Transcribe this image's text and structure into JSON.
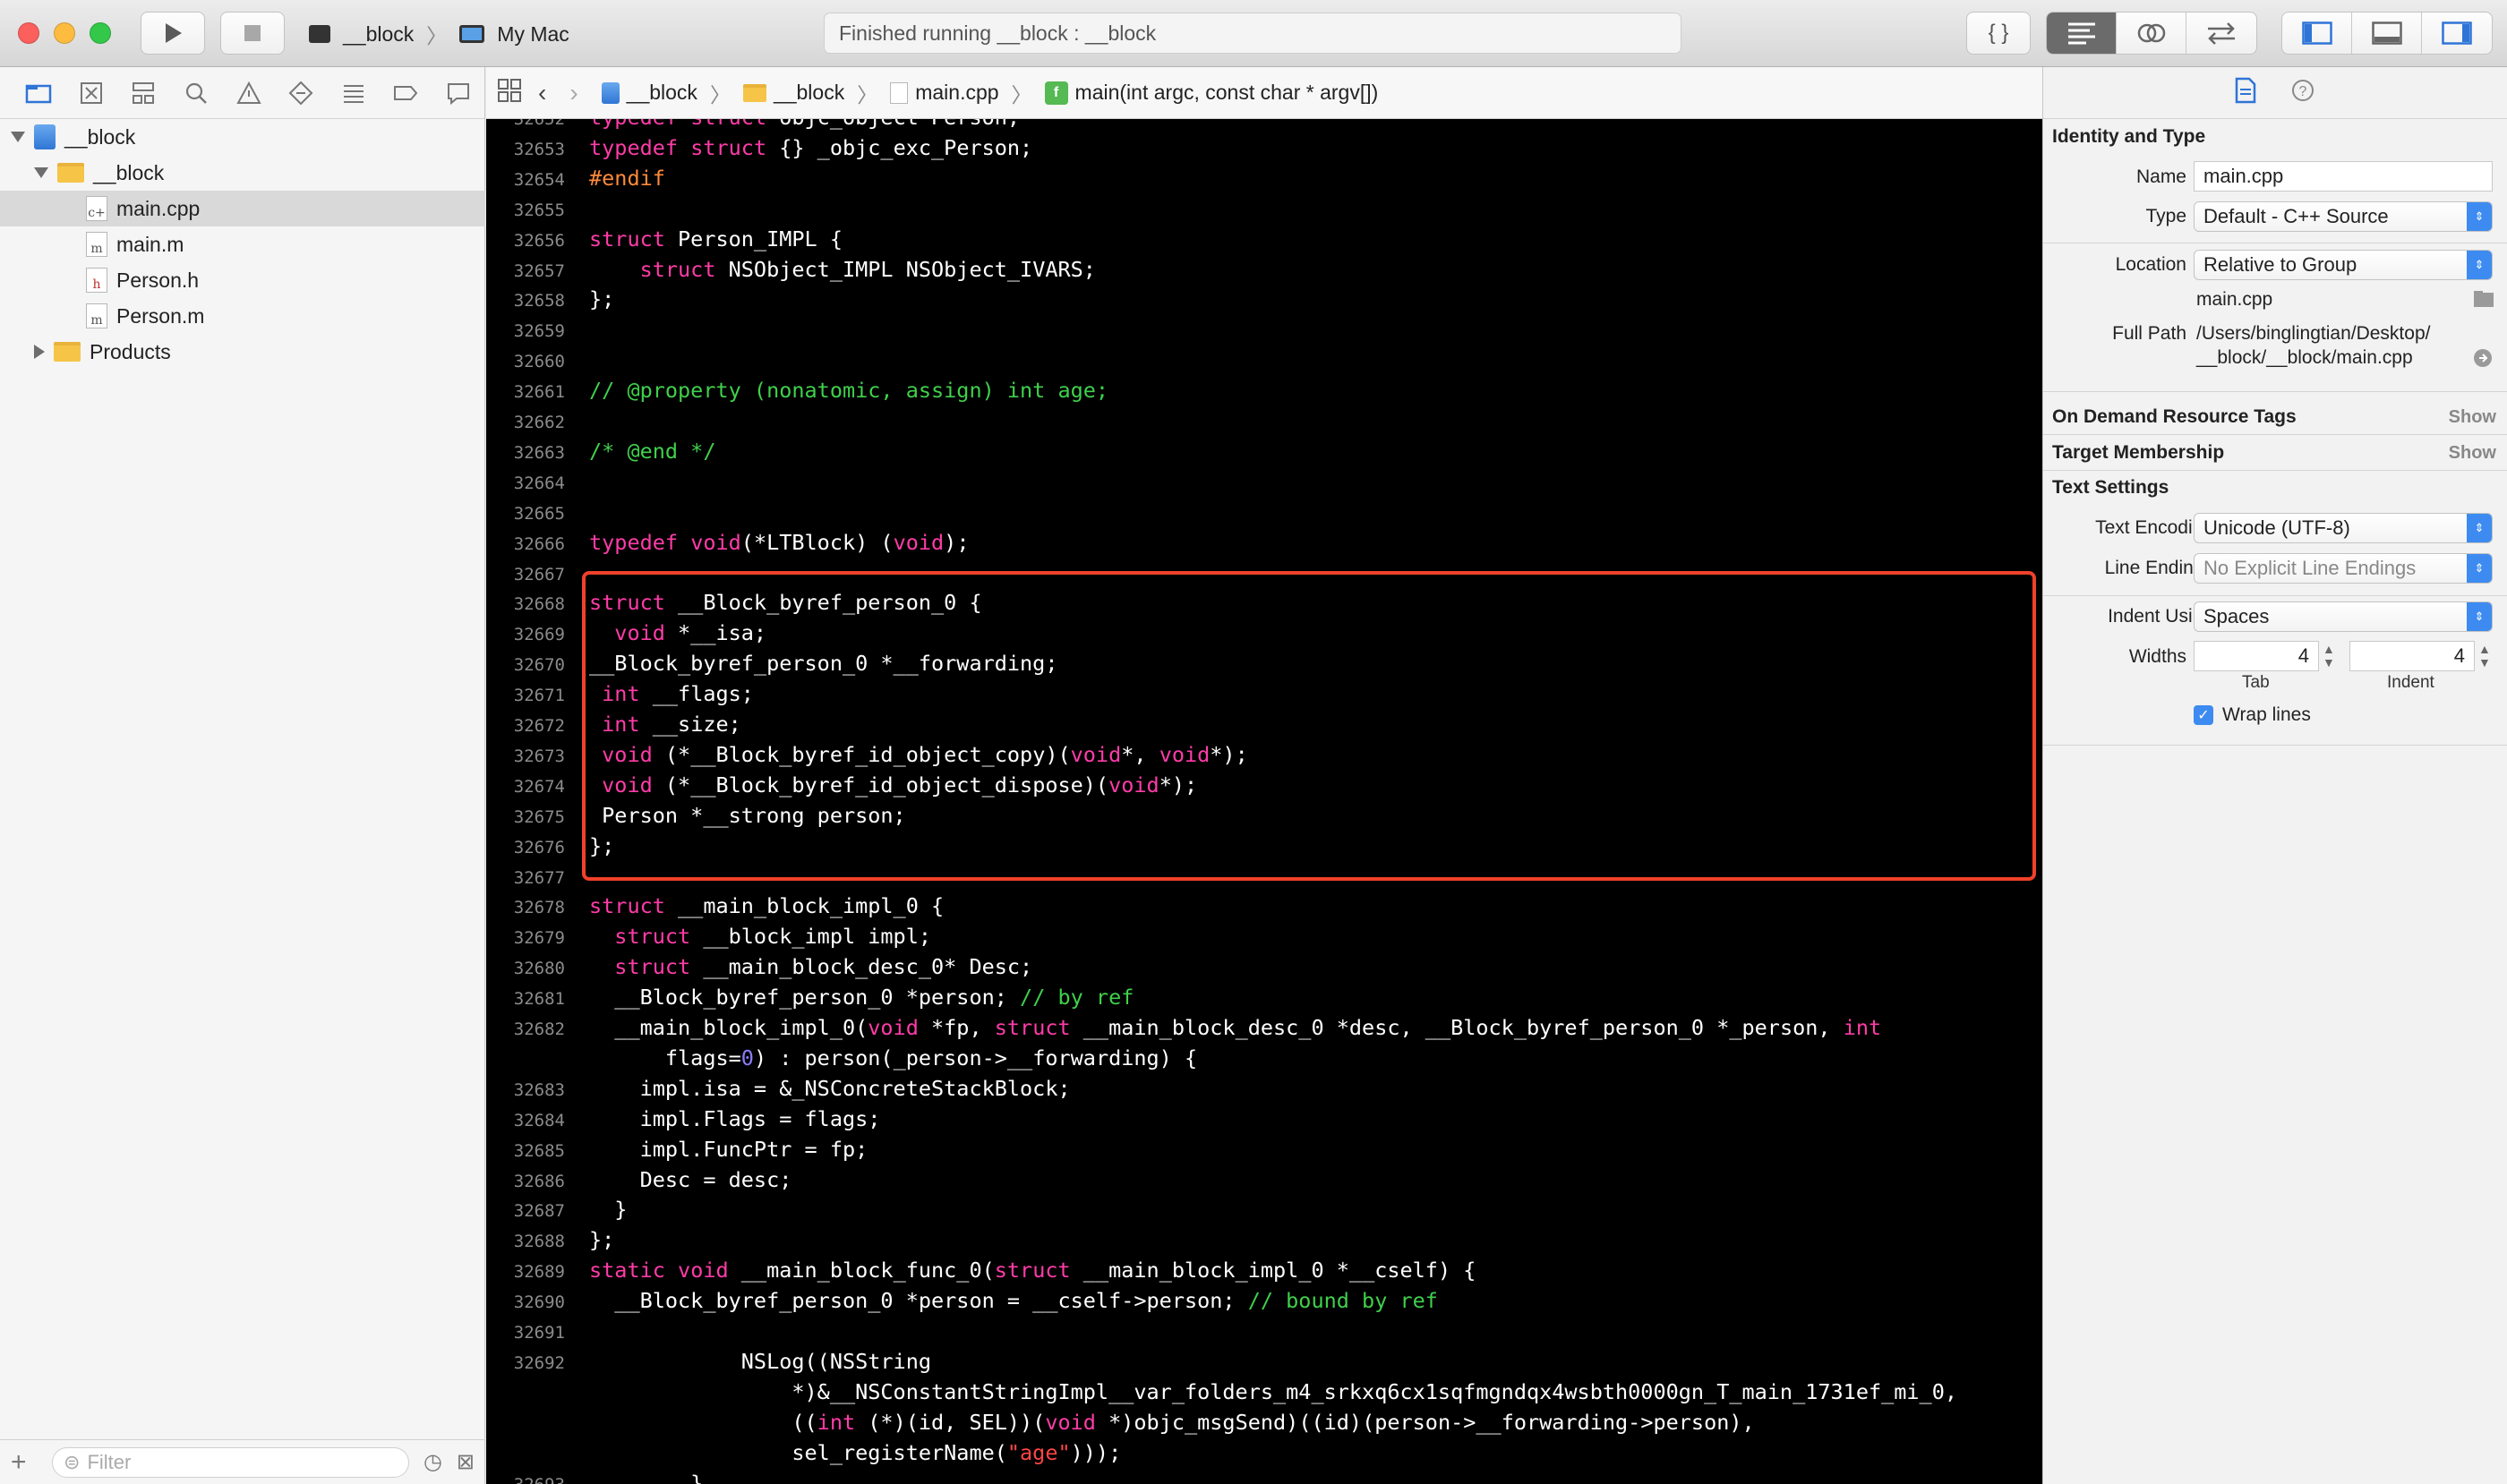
{
  "toolbar": {
    "scheme": "__block",
    "destination": "My Mac",
    "activity": "Finished running __block : __block",
    "braces": "{ }"
  },
  "navigator": {
    "items": [
      {
        "label": "__block",
        "kind": "project",
        "expanded": true
      },
      {
        "label": "__block",
        "kind": "folder",
        "expanded": true
      },
      {
        "label": "main.cpp",
        "kind": "file",
        "glyph": "c+",
        "selected": true
      },
      {
        "label": "main.m",
        "kind": "file",
        "glyph": "m"
      },
      {
        "label": "Person.h",
        "kind": "file",
        "glyph": "h"
      },
      {
        "label": "Person.m",
        "kind": "file",
        "glyph": "m"
      },
      {
        "label": "Products",
        "kind": "folder",
        "expanded": false
      }
    ],
    "filter_placeholder": "Filter"
  },
  "jumpbar": {
    "project": "__block",
    "group": "__block",
    "file": "main.cpp",
    "symbol": "main(int argc, const char * argv[])"
  },
  "editor": {
    "lines": [
      {
        "n": "32652",
        "h": "<span class=\"kw\">typedef</span> <span class=\"kw\">struct</span> objc_object Person;"
      },
      {
        "n": "32653",
        "h": "<span class=\"kw\">typedef</span> <span class=\"kw\">struct</span> {} _objc_exc_Person;"
      },
      {
        "n": "32654",
        "h": "<span class=\"pp\">#endif</span>"
      },
      {
        "n": "32655",
        "h": ""
      },
      {
        "n": "32656",
        "h": "<span class=\"kw\">struct</span> Person_IMPL {"
      },
      {
        "n": "32657",
        "h": "    <span class=\"kw\">struct</span> NSObject_IMPL NSObject_IVARS;"
      },
      {
        "n": "32658",
        "h": "};"
      },
      {
        "n": "32659",
        "h": ""
      },
      {
        "n": "32660",
        "h": ""
      },
      {
        "n": "32661",
        "h": "<span class=\"cm\">// @property (nonatomic, assign) int age;</span>"
      },
      {
        "n": "32662",
        "h": ""
      },
      {
        "n": "32663",
        "h": "<span class=\"cm\">/* @end */</span>"
      },
      {
        "n": "32664",
        "h": ""
      },
      {
        "n": "32665",
        "h": ""
      },
      {
        "n": "32666",
        "h": "<span class=\"kw\">typedef</span> <span class=\"kw\">void</span>(*LTBlock) (<span class=\"kw\">void</span>);"
      },
      {
        "n": "32667",
        "h": ""
      },
      {
        "n": "32668",
        "h": "<span class=\"kw\">struct</span> __Block_byref_person_0 {"
      },
      {
        "n": "32669",
        "h": "  <span class=\"kw\">void</span> *__isa;"
      },
      {
        "n": "32670",
        "h": "__Block_byref_person_0 *__forwarding;"
      },
      {
        "n": "32671",
        "h": " <span class=\"kw\">int</span> __flags;"
      },
      {
        "n": "32672",
        "h": " <span class=\"kw\">int</span> __size;"
      },
      {
        "n": "32673",
        "h": " <span class=\"kw\">void</span> (*__Block_byref_id_object_copy)(<span class=\"kw\">void</span>*, <span class=\"kw\">void</span>*);"
      },
      {
        "n": "32674",
        "h": " <span class=\"kw\">void</span> (*__Block_byref_id_object_dispose)(<span class=\"kw\">void</span>*);"
      },
      {
        "n": "32675",
        "h": " Person *__strong person;"
      },
      {
        "n": "32676",
        "h": "};"
      },
      {
        "n": "32677",
        "h": ""
      },
      {
        "n": "32678",
        "h": "<span class=\"kw\">struct</span> __main_block_impl_0 {"
      },
      {
        "n": "32679",
        "h": "  <span class=\"kw\">struct</span> __block_impl impl;"
      },
      {
        "n": "32680",
        "h": "  <span class=\"kw\">struct</span> __main_block_desc_0* Desc;"
      },
      {
        "n": "32681",
        "h": "  __Block_byref_person_0 *person; <span class=\"cm\">// by ref</span>"
      },
      {
        "n": "32682",
        "h": "  __main_block_impl_0(<span class=\"kw\">void</span> *fp, <span class=\"kw\">struct</span> __main_block_desc_0 *desc, __Block_byref_person_0 *_person, <span class=\"kw\">int</span>"
      },
      {
        "n": "",
        "h": "      flags=<span class=\"num\">0</span>) : person(_person->__forwarding) {"
      },
      {
        "n": "32683",
        "h": "    impl.isa = &_NSConcreteStackBlock;"
      },
      {
        "n": "32684",
        "h": "    impl.Flags = flags;"
      },
      {
        "n": "32685",
        "h": "    impl.FuncPtr = fp;"
      },
      {
        "n": "32686",
        "h": "    Desc = desc;"
      },
      {
        "n": "32687",
        "h": "  }"
      },
      {
        "n": "32688",
        "h": "};"
      },
      {
        "n": "32689",
        "h": "<span class=\"kw\">static</span> <span class=\"kw\">void</span> __main_block_func_0(<span class=\"kw\">struct</span> __main_block_impl_0 *__cself) {"
      },
      {
        "n": "32690",
        "h": "  __Block_byref_person_0 *person = __cself->person; <span class=\"cm\">// bound by ref</span>"
      },
      {
        "n": "32691",
        "h": ""
      },
      {
        "n": "32692",
        "h": "            NSLog((NSString"
      },
      {
        "n": "",
        "h": "                *)&__NSConstantStringImpl__var_folders_m4_srkxq6cx1sqfmgndqx4wsbth0000gn_T_main_1731ef_mi_0,"
      },
      {
        "n": "",
        "h": "                ((<span class=\"kw\">int</span> (*)(id, SEL))(<span class=\"kw\">void</span> *)objc_msgSend)((id)(person->__forwarding->person),"
      },
      {
        "n": "",
        "h": "                sel_registerName(<span class=\"str\">\"age\"</span>)));"
      },
      {
        "n": "32693",
        "h": "        }"
      }
    ]
  },
  "inspector": {
    "identity_title": "Identity and Type",
    "name_label": "Name",
    "name_value": "main.cpp",
    "type_label": "Type",
    "type_value": "Default - C++ Source",
    "location_label": "Location",
    "location_value": "Relative to Group",
    "location_file": "main.cpp",
    "fullpath_label": "Full Path",
    "fullpath_line1": "/Users/binglingtian/Desktop/",
    "fullpath_line2": "__block/__block/main.cpp",
    "odr_title": "On Demand Resource Tags",
    "odr_show": "Show",
    "target_title": "Target Membership",
    "target_show": "Show",
    "text_title": "Text Settings",
    "encoding_label": "Text Encoding",
    "encoding_value": "Unicode (UTF-8)",
    "endings_label": "Line Endings",
    "endings_value": "No Explicit Line Endings",
    "indent_label": "Indent Using",
    "indent_value": "Spaces",
    "widths_label": "Widths",
    "tab_value": "4",
    "indent_width_value": "4",
    "tab_caption": "Tab",
    "indent_caption": "Indent",
    "wrap_label": "Wrap lines",
    "wrap_checked": true
  }
}
